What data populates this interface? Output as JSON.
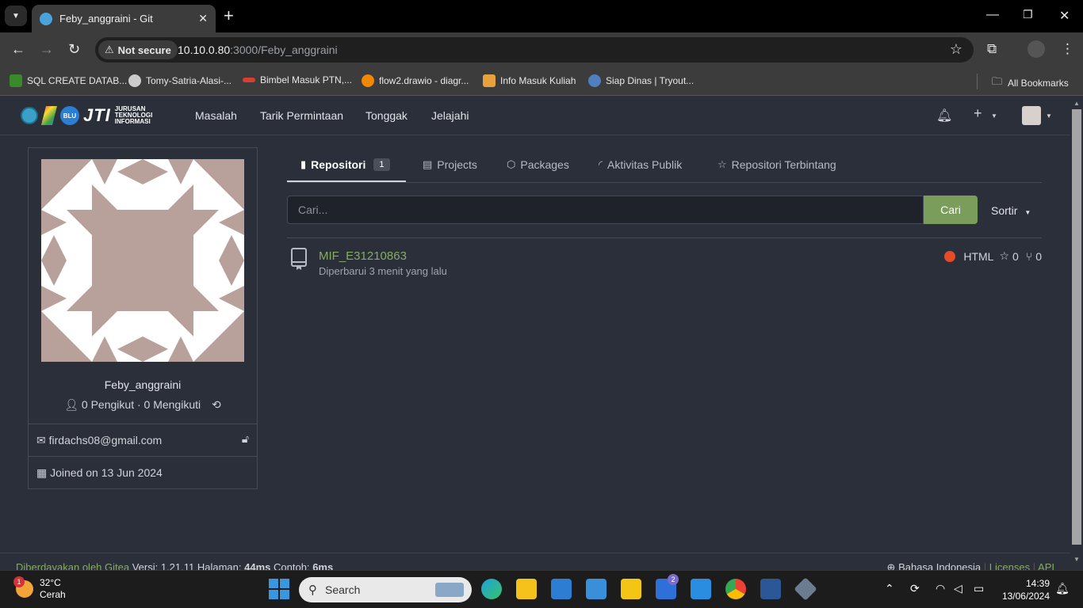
{
  "browser": {
    "tab_title": "Feby_anggraini - Git",
    "close_tab": "✕",
    "new_tab": "+",
    "not_secure": "Not secure",
    "url_host": "10.10.0.80",
    "url_path": ":3000/Feby_anggraini",
    "bookmarks": [
      {
        "label": "SQL CREATE DATAB...",
        "color": "#3a8a2c"
      },
      {
        "label": "Tomy-Satria-Alasi-...",
        "color": "#cccccc"
      },
      {
        "label": "Bimbel Masuk PTN,...",
        "color": "#d64031"
      },
      {
        "label": "flow2.drawio - diagr...",
        "color": "#f08705"
      },
      {
        "label": "Info Masuk Kuliah",
        "color": "#e8a23c"
      },
      {
        "label": "Siap Dinas | Tryout...",
        "color": "#4f7fbf"
      }
    ],
    "all_bookmarks": "All Bookmarks"
  },
  "navbar": {
    "logo_badge": "BLU",
    "logo_text": "JTI",
    "logo_sub": [
      "JURUSAN",
      "TEKNOLOGI",
      "INFORMASI"
    ],
    "items": [
      "Masalah",
      "Tarik Permintaan",
      "Tonggak",
      "Jelajahi"
    ]
  },
  "profile": {
    "username": "Feby_anggraini",
    "followers": "0 Pengikut · 0 Mengikuti",
    "email": "firdachs08@gmail.com",
    "joined": "Joined on 13 Jun 2024"
  },
  "tabs": {
    "repositori": "Repositori",
    "repositori_count": "1",
    "projects": "Projects",
    "packages": "Packages",
    "activity": "Aktivitas Publik",
    "starred": "Repositori Terbintang"
  },
  "search": {
    "placeholder": "Cari...",
    "button": "Cari",
    "sort": "Sortir"
  },
  "repos": [
    {
      "name": "MIF_E31210863",
      "updated": "Diperbarui 3 menit yang lalu",
      "language": "HTML",
      "language_color": "#e34c26",
      "stars": "0",
      "forks": "0"
    }
  ],
  "footer": {
    "powered": "Diberdayakan oleh Gitea",
    "version": "Versi: 1.21.11 Halaman:",
    "page_time": "44ms",
    "template_label": "Contoh:",
    "template_time": "6ms",
    "language": "Bahasa Indonesia",
    "licenses": "Licenses",
    "api": "API"
  },
  "taskbar": {
    "weather_badge": "1",
    "temperature": "32°C",
    "condition": "Cerah",
    "search_placeholder": "Search",
    "todo_badge": "2",
    "time": "14:39",
    "date": "13/06/2024"
  }
}
